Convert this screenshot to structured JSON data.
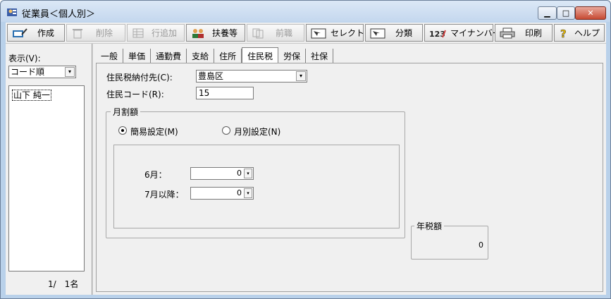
{
  "window": {
    "title": "従業員＜個人別＞"
  },
  "toolbar": {
    "create": "作成",
    "delete": "削除",
    "add_row": "行追加",
    "dependents": "扶養等",
    "previous_job": "前職",
    "select": "セレクト",
    "classify": "分類",
    "mynumber": "マイナンバー",
    "print": "印刷",
    "help": "ヘルプ"
  },
  "left": {
    "display_label": "表示(V):",
    "sort_value": "コード順",
    "items": [
      "山下 純一"
    ],
    "count": "1/　1名"
  },
  "tabs": [
    "一般",
    "単価",
    "通勤費",
    "支給",
    "住所",
    "住民税",
    "労保",
    "社保"
  ],
  "active_tab": "住民税",
  "form": {
    "payee_label": "住民税納付先(C):",
    "payee_value": "豊島区",
    "code_label": "住民コード(R):",
    "code_value": "15",
    "monthly_group": "月割額",
    "simple_label": "簡易設定(M)",
    "monthly_label": "月別設定(N)",
    "june_label": "6月：",
    "june_value": "0",
    "july_label": "7月以降：",
    "july_value": "0",
    "annual_group": "年税額",
    "annual_value": "0"
  }
}
